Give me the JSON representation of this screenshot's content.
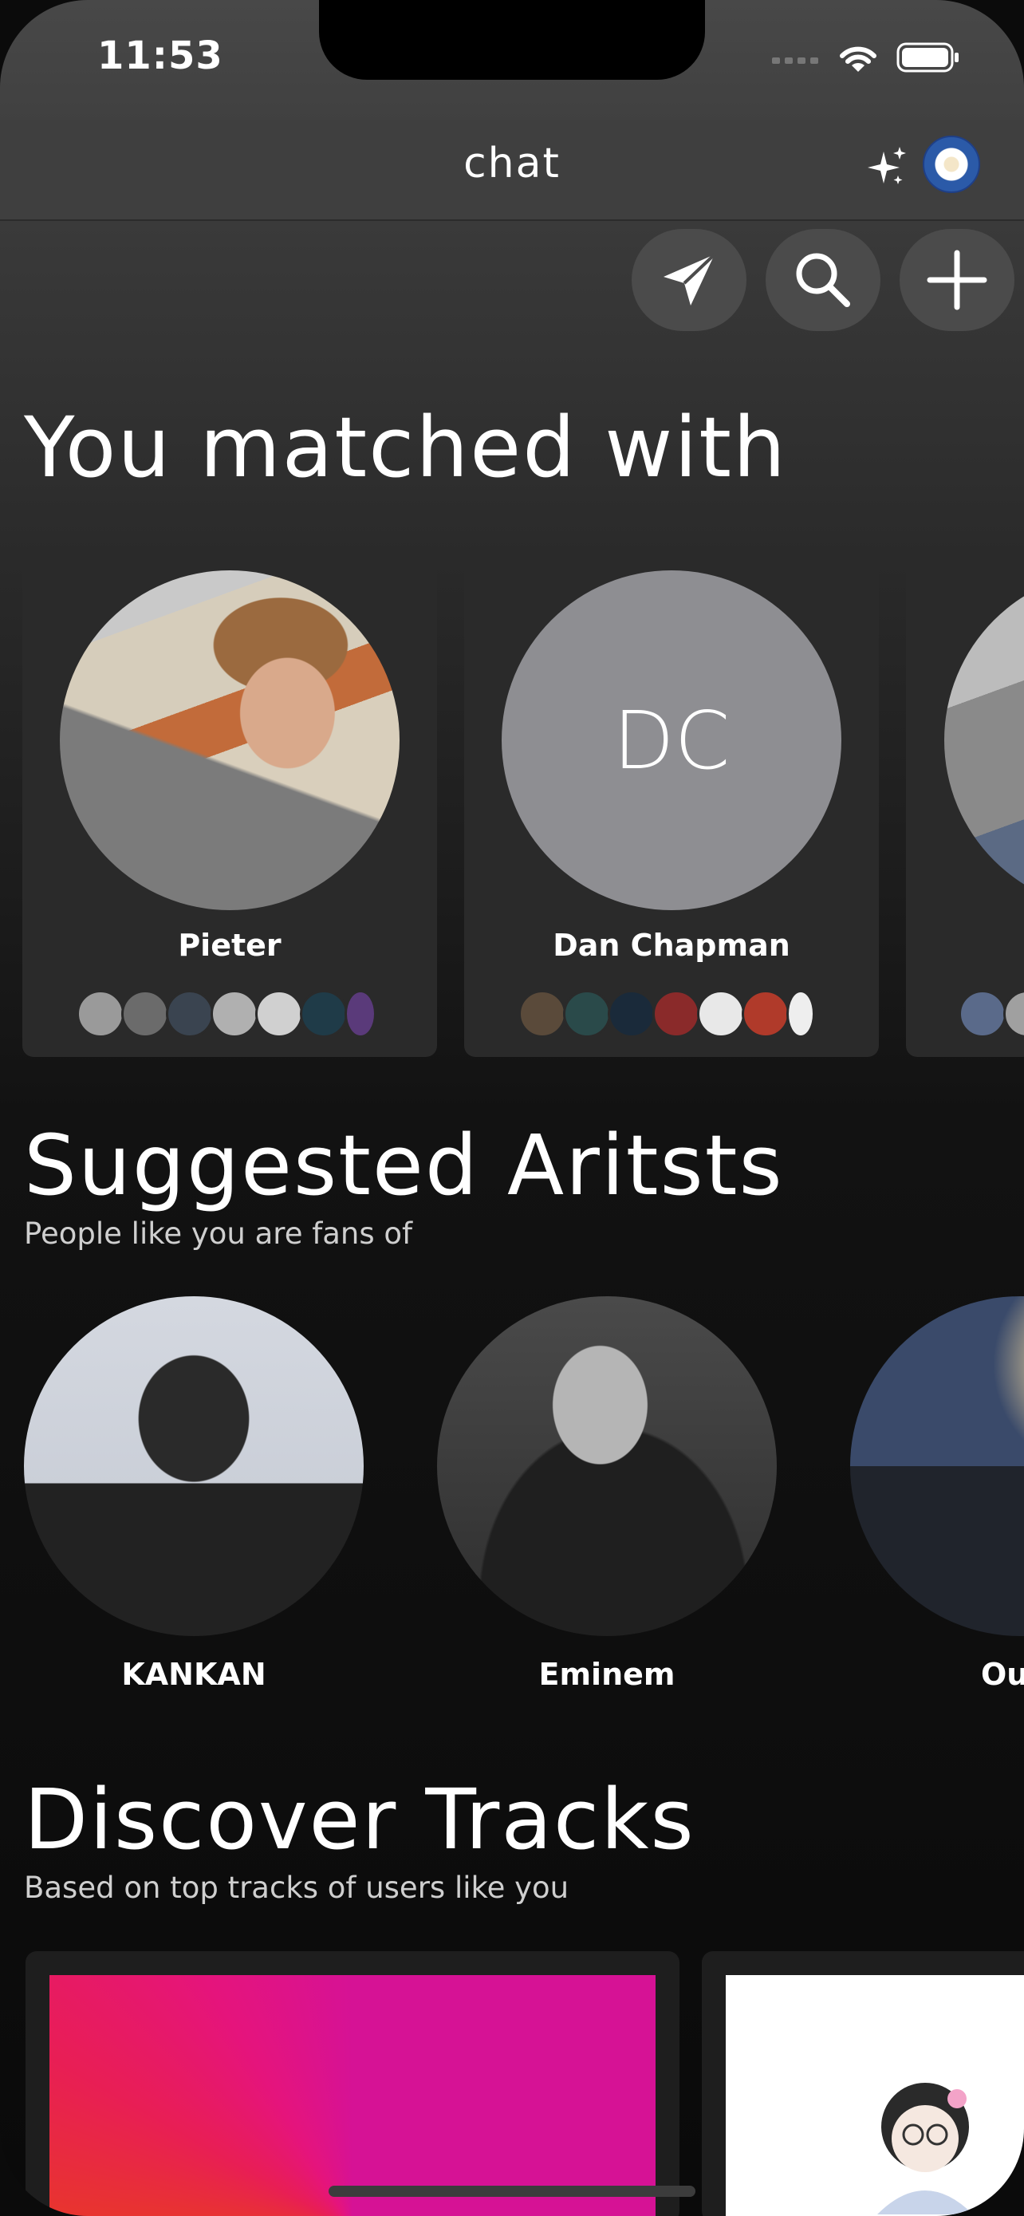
{
  "status_bar": {
    "time": "11:53"
  },
  "nav": {
    "title": "chat"
  },
  "sections": {
    "matched": {
      "title": "You matched with"
    },
    "artists": {
      "title": "Suggested Aritsts",
      "subtitle": "People like you are fans of"
    },
    "tracks": {
      "title": "Discover Tracks",
      "subtitle": "Based on top tracks of users like you"
    }
  },
  "matches": [
    {
      "name": "Pieter",
      "initials": ""
    },
    {
      "name": "Dan Chapman",
      "initials": "DC"
    },
    {
      "name": "",
      "initials": ""
    }
  ],
  "artists": [
    {
      "name": "KANKAN"
    },
    {
      "name": "Eminem"
    },
    {
      "name": "Ou"
    }
  ],
  "icons": {
    "send": "paper-plane-icon",
    "search": "search-icon",
    "add": "plus-icon",
    "sparkle": "sparkle-icon"
  },
  "colors": {
    "background": "#0b0b0b",
    "card": "#2a2a2a",
    "initials_avatar": "#8e8e92"
  }
}
